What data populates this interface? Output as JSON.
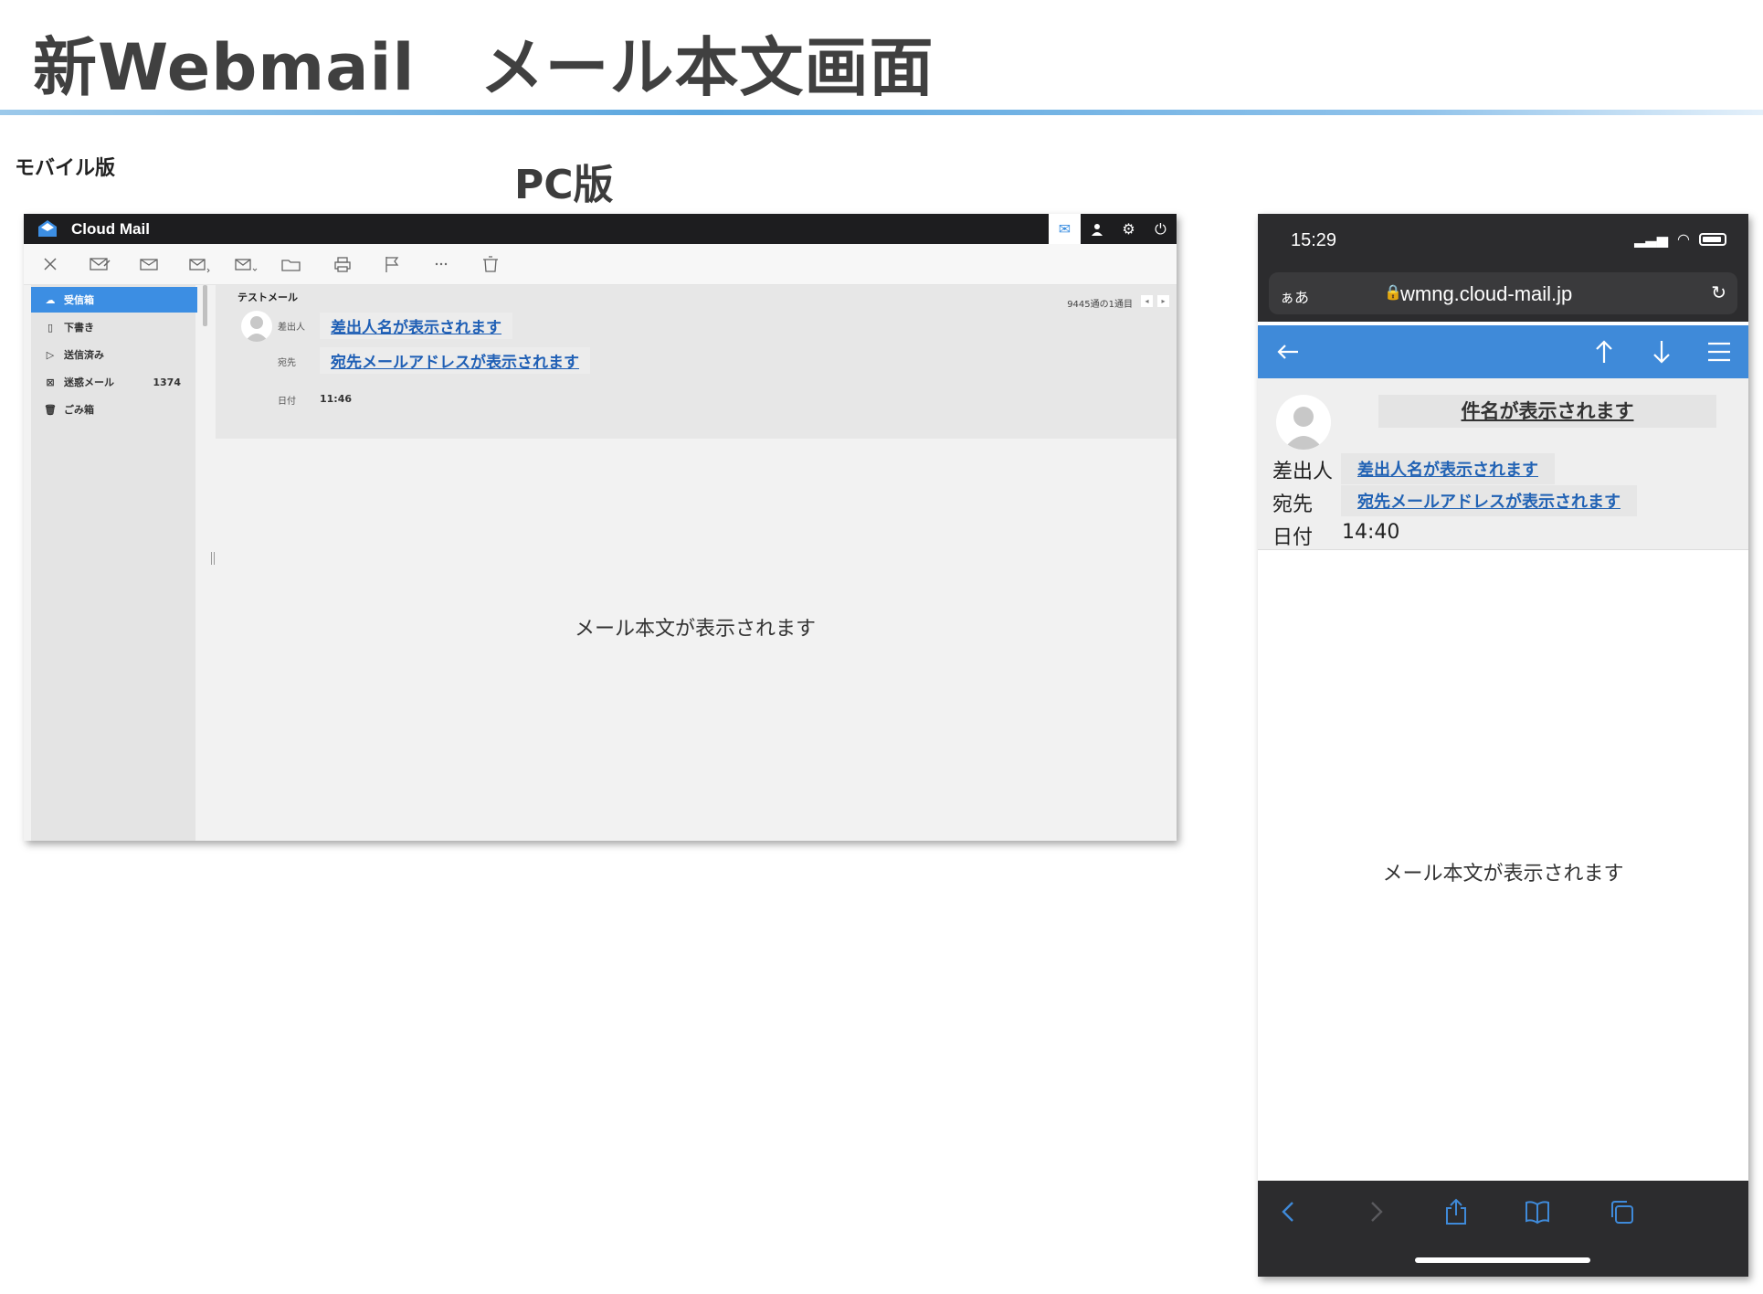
{
  "page": {
    "title": "新Webmail　メール本文画面",
    "pc_label": "PC版",
    "mobile_label": "モバイル版"
  },
  "pc": {
    "brand": "Cloud Mail",
    "folders": [
      {
        "label": "受信箱",
        "icon": "inbox-icon",
        "count": ""
      },
      {
        "label": "下書き",
        "icon": "draft-icon",
        "count": ""
      },
      {
        "label": "送信済み",
        "icon": "sent-icon",
        "count": ""
      },
      {
        "label": "迷惑メール",
        "icon": "spam-icon",
        "count": "1374"
      },
      {
        "label": "ごみ箱",
        "icon": "trash-icon",
        "count": ""
      }
    ],
    "message": {
      "subject": "テストメール",
      "position": "9445通の1通目",
      "from_label": "差出人",
      "from_value": "差出人名が表示されます",
      "to_label": "宛先",
      "to_value": "宛先メールアドレスが表示されます",
      "date_label": "日付",
      "date_value": "11:46",
      "body": "メール本文が表示されます"
    },
    "accent": "#3c8ee3"
  },
  "mobile": {
    "time": "15:29",
    "aa": "ぁあ",
    "url": "wmng.cloud-mail.jp",
    "subject": "件名が表示されます",
    "from_label": "差出人",
    "from_value": "差出人名が表示されます",
    "to_label": "宛先",
    "to_value": "宛先メールアドレスが表示されます",
    "date_label": "日付",
    "date_value": "14:40",
    "body": "メール本文が表示されます",
    "accent": "#3f8ad9"
  }
}
